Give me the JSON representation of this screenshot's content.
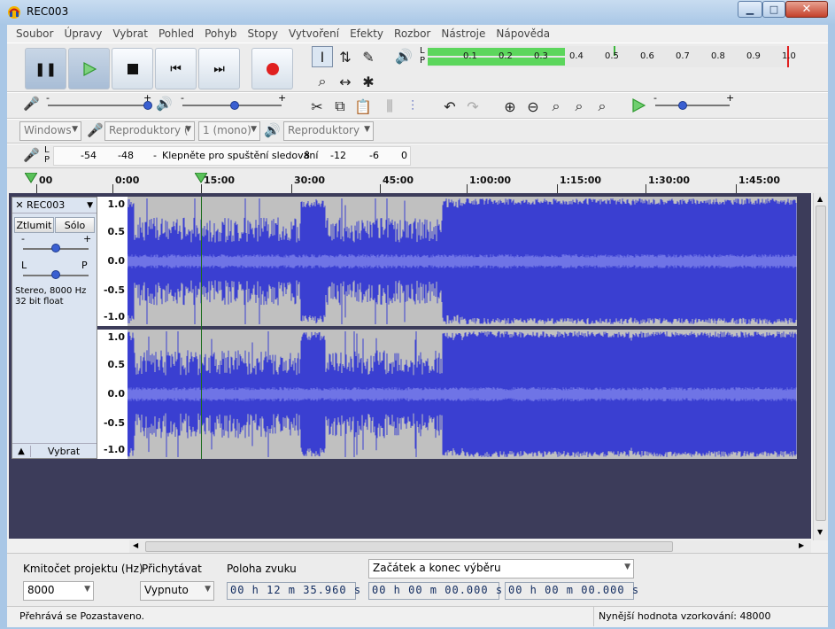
{
  "window": {
    "title": "REC003"
  },
  "menu": [
    "Soubor",
    "Úpravy",
    "Vybrat",
    "Pohled",
    "Pohyb",
    "Stopy",
    "Vytvoření",
    "Efekty",
    "Rozbor",
    "Nástroje",
    "Nápověda"
  ],
  "playback_meter": {
    "lr": "L\nP",
    "ticks": [
      "0.1",
      "0.2",
      "0.3",
      "0.4",
      "0.5",
      "0.6",
      "0.7",
      "0.8",
      "0.9",
      "1.0"
    ],
    "level": 0.38
  },
  "record_meter": {
    "ticks": [
      "-54",
      "-48",
      "-",
      "8",
      "-12",
      "-6",
      "0"
    ],
    "hint": "Klepněte pro spuštění sledování"
  },
  "devices": {
    "host": "Windows",
    "input": "Reproduktory (",
    "channels": "1 (mono)",
    "output": "Reproduktory"
  },
  "timeline": {
    "ticks": [
      "00",
      "0:00",
      "15:00",
      "30:00",
      "45:00",
      "1:00:00",
      "1:15:00",
      "1:30:00",
      "1:45:00"
    ]
  },
  "track": {
    "name": "REC003",
    "mute": "Ztlumit",
    "solo": "Sólo",
    "pan_left": "L",
    "pan_right": "P",
    "gain_minus": "-",
    "gain_plus": "+",
    "info_line1": "Stereo, 8000 Hz",
    "info_line2": "32 bit float",
    "select": "Vybrat",
    "y_labels": [
      "1.0",
      "0.5",
      "0.0",
      "-0.5",
      "-1.0"
    ]
  },
  "selection_bar": {
    "rate_label": "Kmitočet projektu (Hz)",
    "rate_value": "8000",
    "snap_label": "Přichytávat",
    "snap_value": "Vypnuto",
    "position_label": "Poloha zvuku",
    "position_value": "00 h 12 m 35.960 s",
    "selection_mode": "Začátek a konec výběru",
    "sel_start": "00 h 00 m 00.000 s",
    "sel_end": "00 h 00 m 00.000 s"
  },
  "status": {
    "left": "Přehrává se Pozastaveno.",
    "right": "Nynější hodnota vzorkování: 48000"
  },
  "colors": {
    "waveform": "#3a3fd1",
    "waveform_light": "#6f74e6",
    "unselected_bg": "#c0c0c0",
    "play_green": "#3db83d",
    "record_red": "#e02020"
  }
}
